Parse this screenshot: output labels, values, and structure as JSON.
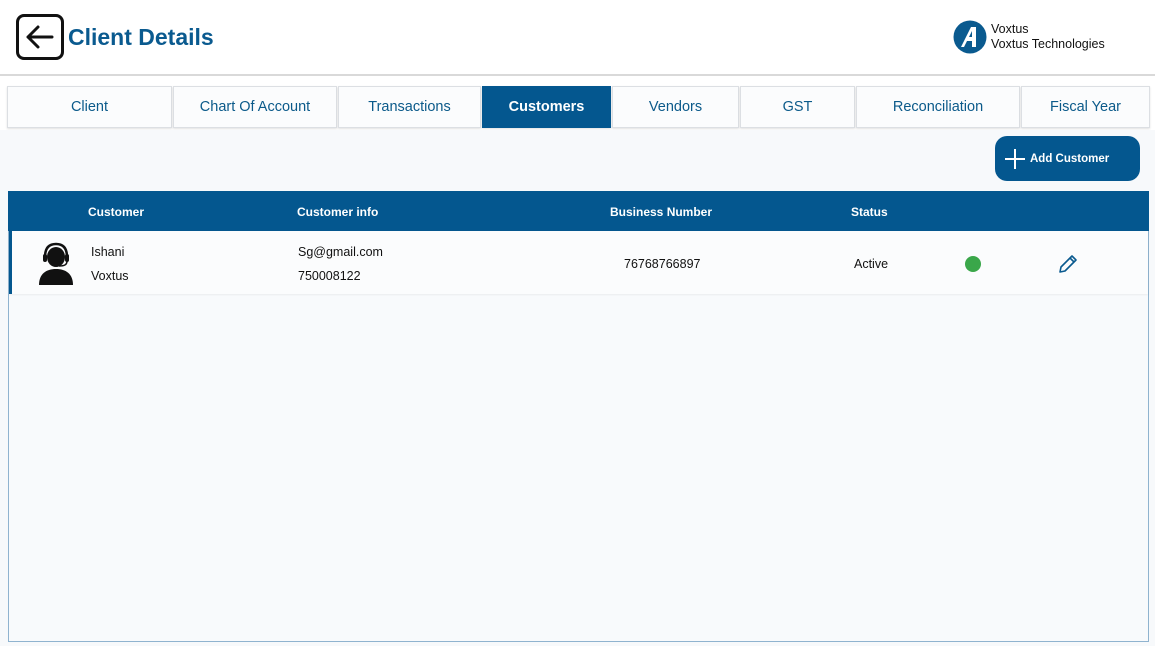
{
  "header": {
    "title": "Client Details",
    "brand": {
      "name": "Voxtus",
      "company": "Voxtus Technologies"
    }
  },
  "tabs": [
    {
      "label": "Client",
      "active": false
    },
    {
      "label": "Chart Of Account",
      "active": false
    },
    {
      "label": "Transactions",
      "active": false
    },
    {
      "label": "Customers",
      "active": true
    },
    {
      "label": "Vendors",
      "active": false
    },
    {
      "label": "GST",
      "active": false
    },
    {
      "label": "Reconciliation",
      "active": false
    },
    {
      "label": "Fiscal Year",
      "active": false
    }
  ],
  "actions": {
    "add_customer_label": "Add Customer"
  },
  "table": {
    "columns": [
      "Customer",
      "Customer info",
      "Business Number",
      "Status"
    ],
    "rows": [
      {
        "first_name": "Ishani",
        "company": "Voxtus",
        "email": "Sg@gmail.com",
        "phone": "750008122",
        "business_number": "76768766897",
        "status": "Active",
        "status_color": "#3aa74a"
      }
    ]
  },
  "colors": {
    "primary": "#04578f",
    "title": "#0a5a8f",
    "active_status": "#3aa74a"
  },
  "icons": [
    "back-arrow-icon",
    "voxtus-logo-icon",
    "plus-icon",
    "avatar-headset-icon",
    "status-dot-icon",
    "edit-pencil-icon"
  ]
}
